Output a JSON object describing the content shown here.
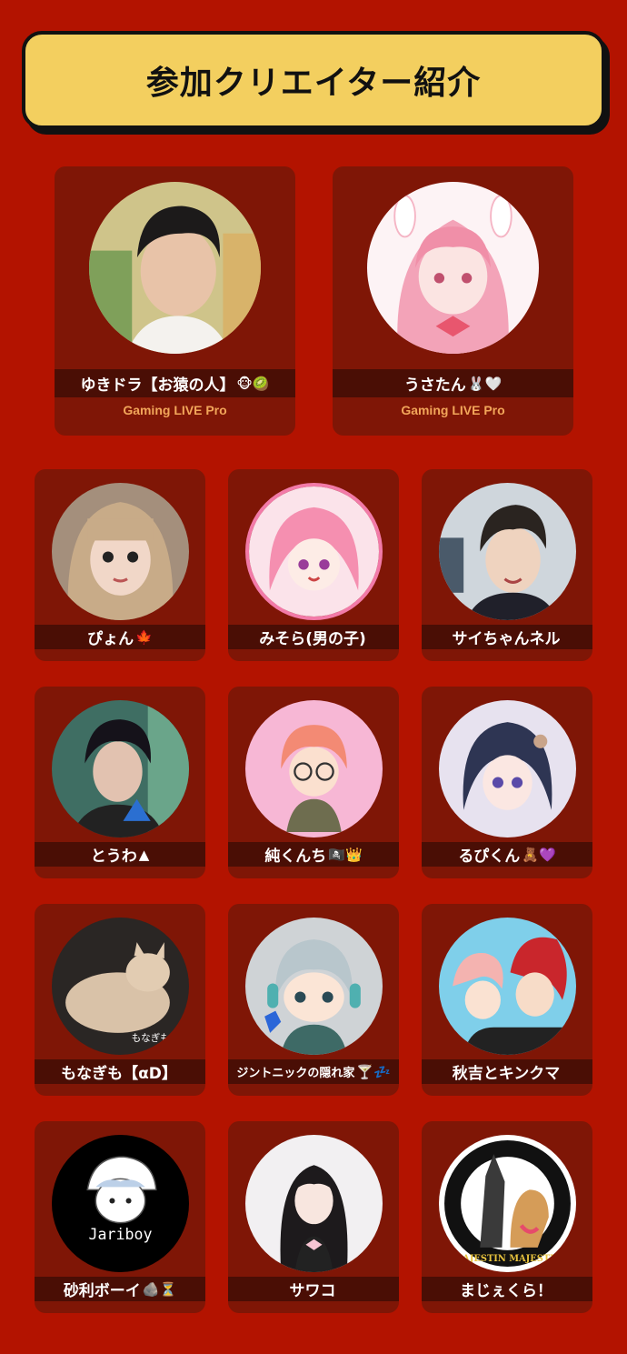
{
  "banner": {
    "title": "参加クリエイター紹介"
  },
  "featured": [
    {
      "name": "ゆきドラ【お猿の人】",
      "emoji": "🐵🥝",
      "label": "Gaming LIVE Pro"
    },
    {
      "name": "うさたん",
      "emoji": "🐰🤍",
      "label": "Gaming LIVE Pro"
    }
  ],
  "creators": [
    {
      "name": "ぴょん",
      "emoji": "🍁"
    },
    {
      "name": "みそら(男の子)",
      "emoji": ""
    },
    {
      "name": "サイちゃんネル",
      "emoji": ""
    },
    {
      "name": "とうわ",
      "emoji": "▲"
    },
    {
      "name": "純くんち",
      "emoji": "🏴‍☠️👑"
    },
    {
      "name": "るぴくん",
      "emoji": "🧸💜"
    },
    {
      "name": "もなぎも【αD】",
      "emoji": ""
    },
    {
      "name": "ジントニックの隠れ家",
      "emoji": "🍸💤"
    },
    {
      "name": "秋吉とキンクマ",
      "emoji": ""
    },
    {
      "name": "砂利ボーイ",
      "emoji": "🪨⏳"
    },
    {
      "name": "サワコ",
      "emoji": ""
    },
    {
      "name": "まじぇくら！",
      "emoji": ""
    }
  ],
  "avatar_texts": {
    "jariboy": "Jariboy",
    "monagimo": "もなぎも",
    "majestin": "MAJESTIN MAJESTIN"
  }
}
